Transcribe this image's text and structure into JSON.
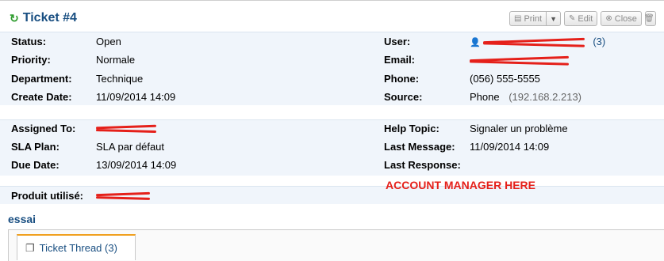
{
  "ticket": {
    "title": "Ticket #4"
  },
  "toolbar": {
    "print": "Print",
    "edit": "Edit",
    "close": "Close"
  },
  "info1": {
    "status_label": "Status:",
    "status_value": "Open",
    "priority_label": "Priority:",
    "priority_value": "Normale",
    "department_label": "Department:",
    "department_value": "Technique",
    "create_label": "Create Date:",
    "create_value": "11/09/2014 14:09",
    "user_label": "User:",
    "user_count": "(3)",
    "email_label": "Email:",
    "phone_label": "Phone:",
    "phone_value": "(056) 555-5555",
    "source_label": "Source:",
    "source_value": "Phone",
    "source_ip": "(192.168.2.213)"
  },
  "info2": {
    "assigned_label": "Assigned To:",
    "sla_label": "SLA Plan:",
    "sla_value": "SLA par défaut",
    "due_label": "Due Date:",
    "due_value": "13/09/2014 14:09",
    "help_label": "Help Topic:",
    "help_value": "Signaler un problème",
    "last_msg_label": "Last Message:",
    "last_msg_value": "11/09/2014 14:09",
    "last_resp_label": "Last Response:"
  },
  "info3": {
    "produit_label": "Produit utilisé:"
  },
  "annotation": "ACCOUNT MANAGER HERE",
  "subject": "essai",
  "thread_tab": "Ticket Thread (3)"
}
